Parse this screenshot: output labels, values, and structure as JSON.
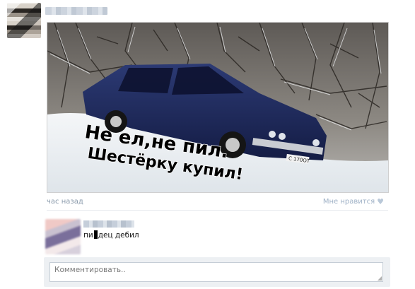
{
  "post": {
    "time": "час назад",
    "like_label": "Мне нравится",
    "image": {
      "caption_line1": "Не ел,не пил.",
      "caption_line2": "Шестёрку купил!",
      "plate": "С 170ОТ"
    }
  },
  "comment": {
    "text_before": "пи",
    "text_after": "дец дебил"
  },
  "reply": {
    "placeholder": "Комментировать.."
  },
  "colors": {
    "meta": "#8a9aab",
    "like": "#9fb1c6",
    "car": "#1e2a5a",
    "snow": "#eef1f4"
  }
}
